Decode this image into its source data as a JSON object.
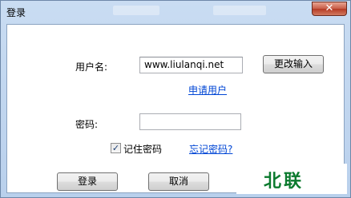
{
  "window": {
    "title": "登录",
    "close_glyph": "✕"
  },
  "form": {
    "username_label": "用户名:",
    "username_value": "www.liulanqi.net",
    "change_input_button": "更改输入",
    "register_link": "申请用户",
    "password_label": "密码:",
    "password_value": "",
    "remember_password_label": "记住密码",
    "remember_password_checked": true,
    "forgot_password_link": "忘记密码?",
    "login_button": "登录",
    "cancel_button": "取消"
  },
  "watermark": {
    "text": "北联",
    "color": "#0b7a2e"
  }
}
